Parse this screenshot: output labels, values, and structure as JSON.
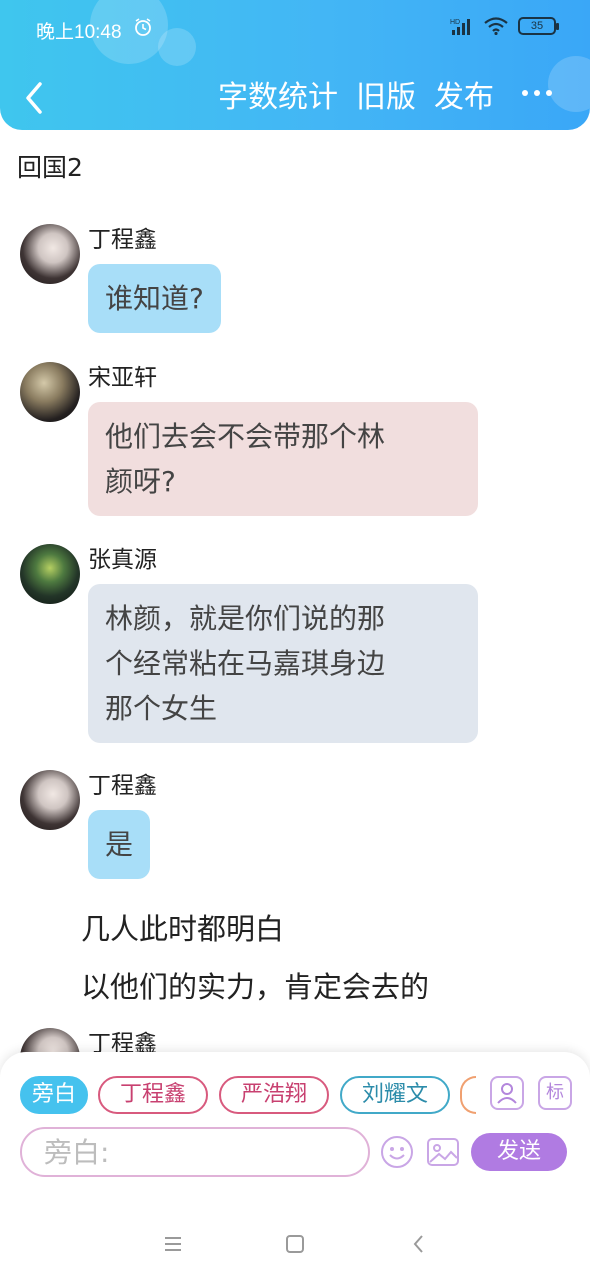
{
  "status_bar": {
    "time": "晚上10:48",
    "battery": "35",
    "icons": [
      "alarm-icon",
      "hd-signal-icon",
      "wifi-icon",
      "battery-icon"
    ]
  },
  "header": {
    "back_icon": "chevron-left-icon",
    "actions": [
      "字数统计",
      "旧版",
      "发布"
    ],
    "more_icon": "more-dots-icon",
    "colors": {
      "gradient_start": "#3fc6ee",
      "gradient_end": "#3aa7f7"
    }
  },
  "content": {
    "chapter_title": "回国2",
    "messages": [
      {
        "sender": "丁程鑫",
        "text": [
          "谁知道?"
        ],
        "bubble_color": "#a8def8"
      },
      {
        "sender": "宋亚轩",
        "text": [
          "他们去会不会带那个林",
          "颜呀?"
        ],
        "bubble_color": "#f1dede"
      },
      {
        "sender": "张真源",
        "text": [
          "林颜，就是你们说的那",
          "个经常粘在马嘉琪身边",
          "那个女生"
        ],
        "bubble_color": "#e0e6ee"
      },
      {
        "sender": "丁程鑫",
        "text": [
          "是"
        ],
        "bubble_color": "#a8def8"
      }
    ],
    "narration": [
      "几人此时都明白",
      "以他们的实力，肯定会去的"
    ],
    "partial_sender": "丁程鑫"
  },
  "composer": {
    "roles": [
      {
        "label": "旁白",
        "active": true
      },
      {
        "label": "丁程鑫",
        "active": false
      },
      {
        "label": "严浩翔",
        "active": false
      },
      {
        "label": "刘耀文",
        "active": false
      }
    ],
    "manage_roles_icon": "person-card-icon",
    "tag_button": "标",
    "input_placeholder": "旁白:",
    "emoji_icon": "smiley-icon",
    "image_icon": "image-icon",
    "send_label": "发送",
    "colors": {
      "send": "#b07be2",
      "narrator_chip": "#45c2ee"
    }
  },
  "system_nav": {
    "icons": [
      "menu-icon",
      "home-square-icon",
      "back-triangle-icon"
    ]
  }
}
